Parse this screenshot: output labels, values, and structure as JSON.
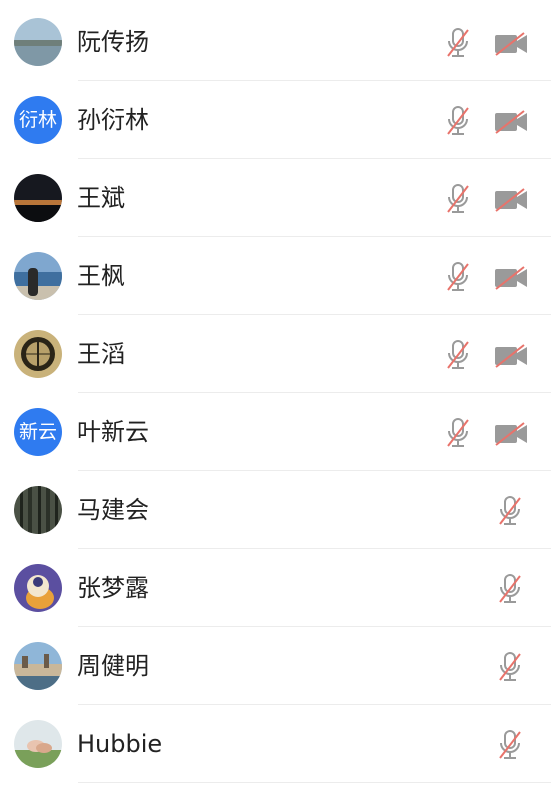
{
  "participants": [
    {
      "name": "阮传扬",
      "avatar_kind": "photo",
      "avatar_theme": "lake",
      "mic_muted": true,
      "camera_shown": true,
      "camera_off": true
    },
    {
      "name": "孙衍林",
      "avatar_kind": "text",
      "avatar_text": "衍林",
      "mic_muted": true,
      "camera_shown": true,
      "camera_off": true
    },
    {
      "name": "王斌",
      "avatar_kind": "photo",
      "avatar_theme": "dusk",
      "mic_muted": true,
      "camera_shown": true,
      "camera_off": true
    },
    {
      "name": "王枫",
      "avatar_kind": "photo",
      "avatar_theme": "seaside-person",
      "mic_muted": true,
      "camera_shown": true,
      "camera_off": true
    },
    {
      "name": "王滔",
      "avatar_kind": "photo",
      "avatar_theme": "emblem",
      "mic_muted": true,
      "camera_shown": true,
      "camera_off": true
    },
    {
      "name": "叶新云",
      "avatar_kind": "text",
      "avatar_text": "新云",
      "mic_muted": true,
      "camera_shown": true,
      "camera_off": true
    },
    {
      "name": "马建会",
      "avatar_kind": "photo",
      "avatar_theme": "bamboo",
      "mic_muted": true,
      "camera_shown": false
    },
    {
      "name": "张梦露",
      "avatar_kind": "photo",
      "avatar_theme": "cartoon-duck",
      "mic_muted": true,
      "camera_shown": false
    },
    {
      "name": "周健明",
      "avatar_kind": "photo",
      "avatar_theme": "city",
      "mic_muted": true,
      "camera_shown": false
    },
    {
      "name": "Hubbie",
      "avatar_kind": "photo",
      "avatar_theme": "hands",
      "mic_muted": true,
      "camera_shown": false
    }
  ],
  "colors": {
    "text_avatar_bg": "#2f7bf0",
    "icon_gray": "#9a9a9a",
    "mute_slash": "#e8736b"
  },
  "icons": {
    "mic": "mic-muted-icon",
    "camera": "camera-off-icon"
  }
}
